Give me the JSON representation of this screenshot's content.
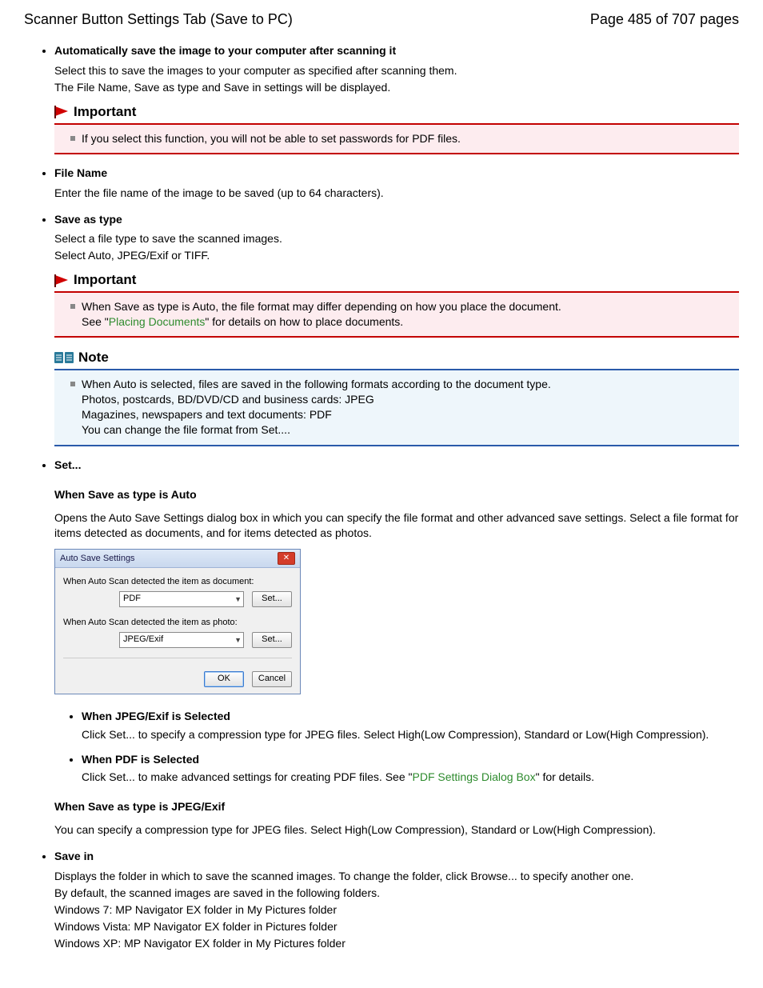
{
  "header": {
    "left": "Scanner Button Settings Tab (Save to PC)",
    "right": "Page 485 of 707 pages"
  },
  "s1": {
    "title": "Automatically save the image to your computer after scanning it",
    "l1": "Select this to save the images to your computer as specified after scanning them.",
    "l2": "The File Name, Save as type and Save in settings will be displayed."
  },
  "imp1": {
    "head": "Important",
    "item": "If you select this function, you will not be able to set passwords for PDF files."
  },
  "s2": {
    "title": "File Name",
    "l1": "Enter the file name of the image to be saved (up to 64 characters)."
  },
  "s3": {
    "title": "Save as type",
    "l1": "Select a file type to save the scanned images.",
    "l2": "Select Auto, JPEG/Exif or TIFF."
  },
  "imp2": {
    "head": "Important",
    "pre": "When Save as type is Auto, the file format may differ depending on how you place the document.",
    "see_pre": "See \"",
    "link": "Placing Documents",
    "see_post": "\" for details on how to place documents."
  },
  "note1": {
    "head": "Note",
    "l1": "When Auto is selected, files are saved in the following formats according to the document type.",
    "l2": "Photos, postcards, BD/DVD/CD and business cards: JPEG",
    "l3": "Magazines, newspapers and text documents: PDF",
    "l4": "You can change the file format from Set...."
  },
  "s4": {
    "title": "Set...",
    "sub_auto": "When Save as type is Auto",
    "auto_body": "Opens the Auto Save Settings dialog box in which you can specify the file format and other advanced save settings. Select a file format for items detected as documents, and for items detected as photos."
  },
  "dialog": {
    "title": "Auto Save Settings",
    "row1_label": "When Auto Scan detected the item as document:",
    "row1_value": "PDF",
    "row2_label": "When Auto Scan detected the item as photo:",
    "row2_value": "JPEG/Exif",
    "set_btn": "Set...",
    "ok": "OK",
    "cancel": "Cancel"
  },
  "inner_jpeg": {
    "title": "When JPEG/Exif is Selected",
    "body": "Click Set... to specify a compression type for JPEG files. Select High(Low Compression), Standard or Low(High Compression)."
  },
  "inner_pdf": {
    "title": "When PDF is Selected",
    "pre": "Click Set... to make advanced settings for creating PDF files. See \"",
    "link": "PDF Settings Dialog Box",
    "post": "\" for details."
  },
  "sub_jpeg": {
    "title": "When Save as type is JPEG/Exif",
    "body": "You can specify a compression type for JPEG files. Select High(Low Compression), Standard or Low(High Compression)."
  },
  "s5": {
    "title": "Save in",
    "l1": "Displays the folder in which to save the scanned images. To change the folder, click Browse... to specify another one.",
    "l2": "By default, the scanned images are saved in the following folders.",
    "l3": "Windows 7: MP Navigator EX folder in My Pictures folder",
    "l4": "Windows Vista: MP Navigator EX folder in Pictures folder",
    "l5": "Windows XP: MP Navigator EX folder in My Pictures folder"
  }
}
